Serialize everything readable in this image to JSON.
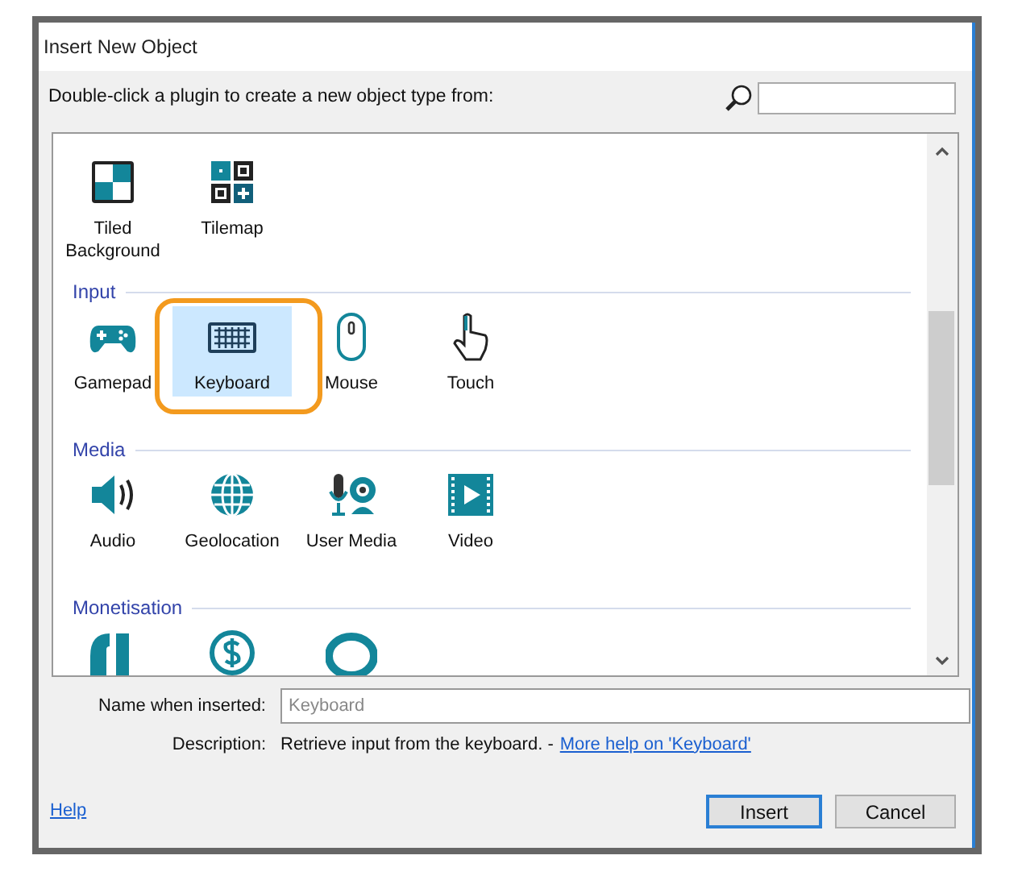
{
  "window": {
    "title": "Insert New Object"
  },
  "instruction": "Double-click a plugin to create a new object type from:",
  "groups": [
    {
      "items": [
        {
          "label": "Tiled Background",
          "selected": false,
          "annotated": false
        },
        {
          "label": "Tilemap",
          "selected": false,
          "annotated": false
        }
      ]
    },
    {
      "title": "Input",
      "items": [
        {
          "label": "Gamepad",
          "selected": false,
          "annotated": false
        },
        {
          "label": "Keyboard",
          "selected": true,
          "annotated": true
        },
        {
          "label": "Mouse",
          "selected": false,
          "annotated": false
        },
        {
          "label": "Touch",
          "selected": false,
          "annotated": false
        }
      ]
    },
    {
      "title": "Media",
      "items": [
        {
          "label": "Audio",
          "selected": false,
          "annotated": false
        },
        {
          "label": "Geolocation",
          "selected": false,
          "annotated": false
        },
        {
          "label": "User Media",
          "selected": false,
          "annotated": false
        },
        {
          "label": "Video",
          "selected": false,
          "annotated": false
        }
      ]
    },
    {
      "title": "Monetisation",
      "items": [
        {
          "selected": false,
          "annotated": false
        },
        {
          "selected": false,
          "annotated": false
        },
        {
          "selected": false,
          "annotated": false
        }
      ]
    }
  ],
  "name_field": {
    "label": "Name when inserted:",
    "placeholder": "Keyboard"
  },
  "description": {
    "label": "Description:",
    "text": "Retrieve input from the keyboard. -",
    "link": "More help on 'Keyboard'"
  },
  "help_link": "Help",
  "buttons": [
    {
      "label": "Insert",
      "default": true
    },
    {
      "label": "Cancel",
      "default": false
    }
  ]
}
